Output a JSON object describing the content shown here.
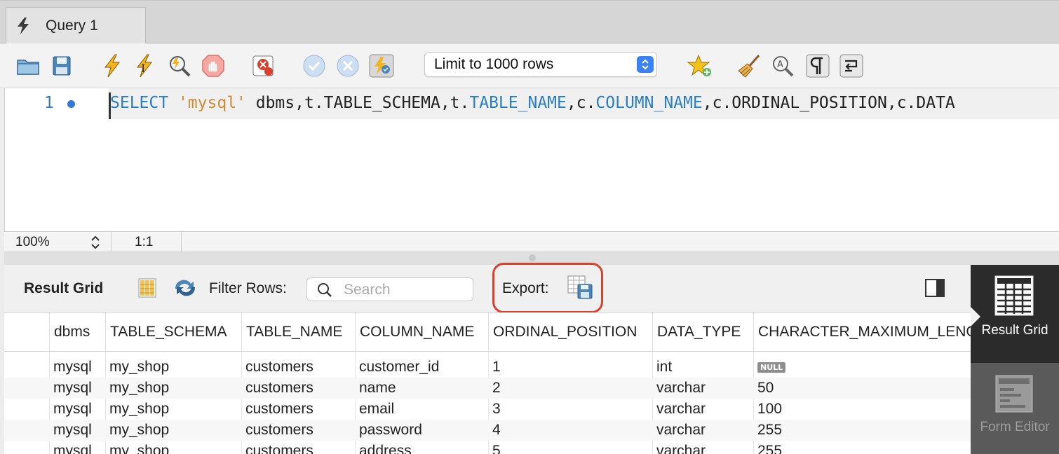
{
  "tab": {
    "label": "Query 1"
  },
  "toolbar": {
    "limit_select": "Limit to 1000 rows"
  },
  "editor": {
    "line_number": "1",
    "code_tokens": [
      {
        "text": "SELECT",
        "cls": "kw"
      },
      {
        "text": " ",
        "cls": "plain"
      },
      {
        "text": "'mysql'",
        "cls": "str"
      },
      {
        "text": " dbms,t.TABLE_SCHEMA,t.",
        "cls": "plain"
      },
      {
        "text": "TABLE_NAME",
        "cls": "kw"
      },
      {
        "text": ",c.",
        "cls": "plain"
      },
      {
        "text": "COLUMN_NAME",
        "cls": "kw"
      },
      {
        "text": ",c.ORDINAL_POSITION,c.DATA",
        "cls": "plain"
      }
    ]
  },
  "status": {
    "zoom": "100%",
    "position": "1:1"
  },
  "result": {
    "title": "Result Grid",
    "filter_label": "Filter Rows:",
    "search_placeholder": "Search",
    "export_label": "Export:"
  },
  "sidebar": {
    "active_label": "Result Grid",
    "inactive_label": "Form Editor"
  },
  "grid": {
    "columns": [
      "dbms",
      "TABLE_SCHEMA",
      "TABLE_NAME",
      "COLUMN_NAME",
      "ORDINAL_POSITION",
      "DATA_TYPE",
      "CHARACTER_MAXIMUM_LENGTH"
    ],
    "rows": [
      [
        "mysql",
        "my_shop",
        "customers",
        "customer_id",
        "1",
        "int",
        "NULL"
      ],
      [
        "mysql",
        "my_shop",
        "customers",
        "name",
        "2",
        "varchar",
        "50"
      ],
      [
        "mysql",
        "my_shop",
        "customers",
        "email",
        "3",
        "varchar",
        "100"
      ],
      [
        "mysql",
        "my_shop",
        "customers",
        "password",
        "4",
        "varchar",
        "255"
      ],
      [
        "mysql",
        "my_shop",
        "customers",
        "address",
        "5",
        "varchar",
        "255"
      ]
    ]
  },
  "colors": {
    "keyword": "#2c7ec4",
    "string": "#d08b34",
    "export_highlight": "#d9412f",
    "sidebar_active": "#2b2b2b"
  },
  "icons": [
    "lightning-icon",
    "open-folder-icon",
    "save-icon",
    "execute-icon",
    "execute-current-icon",
    "explain-icon",
    "stop-icon",
    "toggle-errors-icon",
    "commit-icon",
    "rollback-icon",
    "autocommit-icon",
    "bookmark-star-icon",
    "beautify-broom-icon",
    "find-icon",
    "invisible-chars-icon",
    "wrap-lines-icon",
    "column-toggle-icon",
    "refresh-icon",
    "search-icon",
    "export-icon",
    "panel-toggle-icon",
    "result-grid-icon",
    "form-editor-icon"
  ]
}
